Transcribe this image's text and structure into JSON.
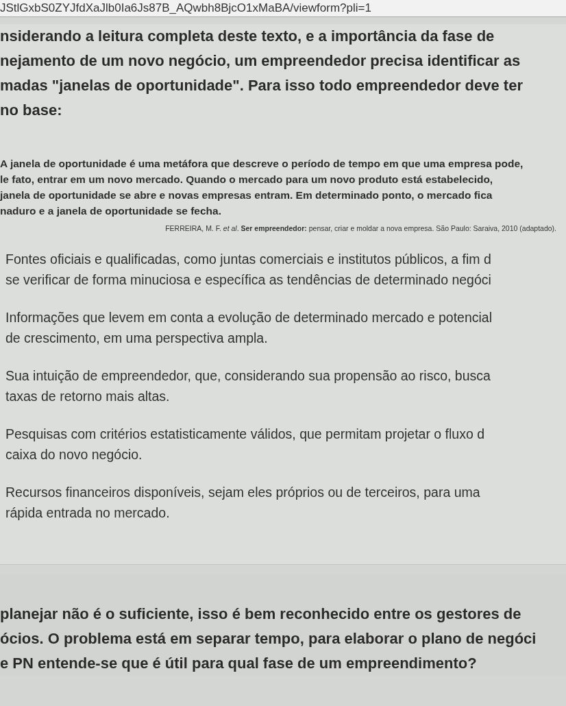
{
  "address_bar": {
    "url": "JStlGxbS0ZYJfdXaJlb0Ia6Js87B_AQwbh8BjcO1xMaBA/viewform?pli=1"
  },
  "question_lines": [
    "nsiderando a leitura completa deste texto, e a importância da fase de",
    "nejamento de um novo negócio, um empreendedor precisa identificar as",
    "madas \"janelas de oportunidade\". Para isso todo empreendedor deve ter",
    "no base:"
  ],
  "quote_lines": [
    "A janela de oportunidade é uma metáfora que descreve o período de tempo em que uma empresa pode,",
    "le fato, entrar em um novo mercado. Quando o mercado para um novo produto está estabelecido,",
    "janela de oportunidade se abre e novas empresas entram. Em determinado ponto, o mercado fica",
    "naduro e a janela de oportunidade se fecha."
  ],
  "citation": "FERREIRA, M. F. *et al*. **Ser empreendedor:** pensar, criar e moldar a nova empresa. São Paulo: Saraiva, 2010 (adaptado).",
  "options": [
    {
      "lines": [
        "Fontes oficiais e qualificadas, como juntas comerciais e institutos públicos, a fim d",
        "se verificar de forma minuciosa e específica as tendências de determinado negóci"
      ]
    },
    {
      "lines": [
        "Informações que levem em conta a evolução de determinado mercado e potencial",
        "de crescimento, em uma perspectiva ampla."
      ]
    },
    {
      "lines": [
        "Sua intuição de empreendedor, que, considerando sua propensão ao risco, busca",
        "taxas de retorno mais altas."
      ]
    },
    {
      "lines": [
        "Pesquisas com critérios estatisticamente válidos, que permitam projetar o fluxo d",
        "caixa do  novo negócio."
      ]
    },
    {
      "lines": [
        "Recursos financeiros disponíveis, sejam eles próprios ou de terceiros, para uma",
        "rápida entrada no mercado."
      ]
    }
  ],
  "next_question_lines": [
    "planejar não é o suficiente, isso é bem reconhecido entre os gestores de",
    "ócios. O problema está em separar tempo, para elaborar o plano de negóci",
    "e PN entende-se que é útil para qual fase de um empreendimento?"
  ]
}
